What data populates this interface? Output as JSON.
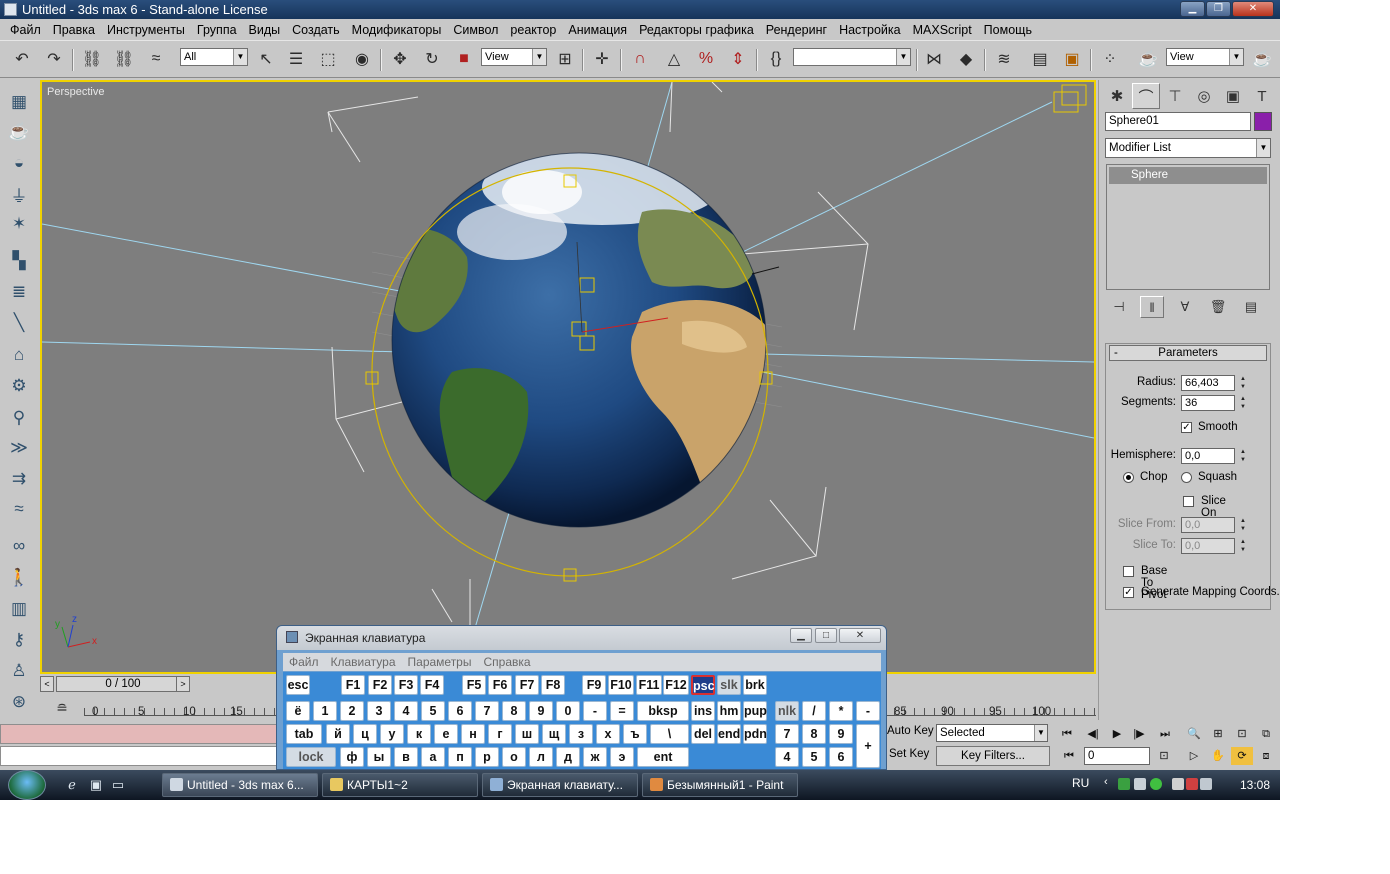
{
  "window": {
    "title": "Untitled - 3ds max 6 - Stand-alone License"
  },
  "menu": [
    "Файл",
    "Правка",
    "Инструменты",
    "Группа",
    "Виды",
    "Создать",
    "Модификаторы",
    "Символ",
    "реактор",
    "Анимация",
    "Редакторы графика",
    "Рендеринг",
    "Настройка",
    "MAXScript",
    "Помощь"
  ],
  "toolbar": {
    "selection_filter": "All",
    "ref_coord": "View",
    "named_selection": "",
    "render_view": "View"
  },
  "viewport": {
    "label": "Perspective",
    "axes": {
      "x": "x",
      "y": "y",
      "z": "z"
    }
  },
  "command_panel": {
    "object_name": "Sphere01",
    "object_color": "#8a1faa",
    "modifier_list": "Modifier List",
    "stack": [
      "Sphere"
    ],
    "rollout_title": "Parameters",
    "params": {
      "radius_label": "Radius:",
      "radius": "66,403",
      "segments_label": "Segments:",
      "segments": "36",
      "smooth_label": "Smooth",
      "smooth": true,
      "hemisphere_label": "Hemisphere:",
      "hemisphere": "0,0",
      "chop_label": "Chop",
      "squash_label": "Squash",
      "hemi_mode": "Chop",
      "slice_on_label": "Slice On",
      "slice_on": false,
      "slice_from_label": "Slice From:",
      "slice_from": "0,0",
      "slice_to_label": "Slice To:",
      "slice_to": "0,0",
      "base_to_pivot_label": "Base To Pivot",
      "base_to_pivot": false,
      "gen_mapping_label": "Generate Mapping Coords.",
      "gen_mapping": true
    }
  },
  "timeline": {
    "slider": "0 / 100",
    "ticks": [
      "0",
      "5",
      "10",
      "15",
      "85",
      "90",
      "95",
      "100"
    ],
    "auto_key": "Auto Key",
    "set_key": "Set Key",
    "key_mode": "Selected",
    "key_filters": "Key Filters...",
    "current_frame": "0"
  },
  "osk": {
    "title": "Экранная клавиатура",
    "menu": [
      "Файл",
      "Клавиатура",
      "Параметры",
      "Справка"
    ],
    "row1": [
      "esc",
      "F1",
      "F2",
      "F3",
      "F4",
      "F5",
      "F6",
      "F7",
      "F8",
      "F9",
      "F10",
      "F11",
      "F12",
      "psc",
      "slk",
      "brk"
    ],
    "row2": [
      "ё",
      "1",
      "2",
      "3",
      "4",
      "5",
      "6",
      "7",
      "8",
      "9",
      "0",
      "-",
      "=",
      "bksp",
      "ins",
      "hm",
      "pup",
      "nlk",
      "/",
      "*",
      "-"
    ],
    "row3": [
      "tab",
      "й",
      "ц",
      "у",
      "к",
      "е",
      "н",
      "г",
      "ш",
      "щ",
      "з",
      "х",
      "ъ",
      "\\",
      "del",
      "end",
      "pdn",
      "7",
      "8",
      "9",
      "+"
    ],
    "row4": [
      "lock",
      "ф",
      "ы",
      "в",
      "а",
      "п",
      "р",
      "о",
      "л",
      "д",
      "ж",
      "э",
      "ent",
      "4",
      "5",
      "6"
    ]
  },
  "taskbar": {
    "items": [
      "Untitled - 3ds max 6...",
      "КАРТЫ1~2",
      "Экранная клавиату...",
      "Безымянный1 - Paint"
    ],
    "lang": "RU",
    "clock": "13:08"
  }
}
